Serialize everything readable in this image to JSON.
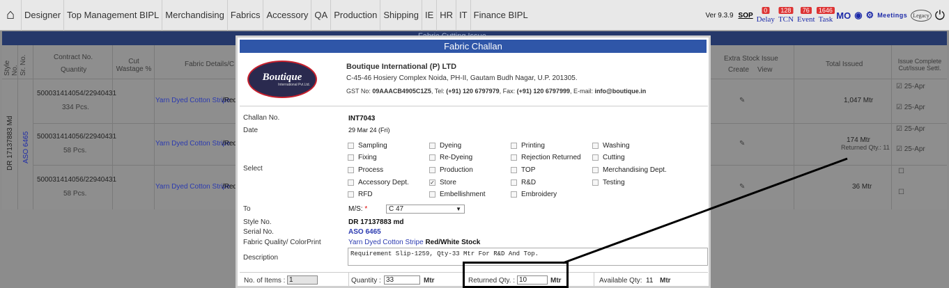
{
  "topbar": {
    "menu": [
      "Designer",
      "Top Management BIPL",
      "Merchandising",
      "Fabrics",
      "Accessory",
      "QA",
      "Production",
      "Shipping",
      "IE",
      "HR",
      "IT",
      "Finance BIPL"
    ],
    "version": "Ver 9.3.9",
    "sop": "SOP",
    "delay_label": "Delay",
    "delay_count": "0",
    "tcn_label": "TCN",
    "tcn_count": "128",
    "event_label": "Event",
    "event_count": "76",
    "task_label": "Task",
    "task_count": "1646",
    "mo_label": "MO",
    "meetings": "Meetings",
    "legacy": "Legacy"
  },
  "background": {
    "title": "Fabric Cutting Issue",
    "headers": {
      "style_no": "Style No.",
      "sr_no": "Sr. No.",
      "contract": "Contract No.",
      "quantity": "Quantity",
      "cut_wastage": "Cut Wastage %",
      "fabric_details": "Fabric Details/C",
      "extra_stock": "Extra Stock Issue",
      "create": "Create",
      "view": "View",
      "total_issued": "Total Issued",
      "issue_complete": "Issue Complete Cut/Issue Settl."
    },
    "style": "DR 17137883 Md",
    "serial": "ASO 6465",
    "rows": [
      {
        "contract": "500031414054/22940431",
        "qty": "334 Pcs.",
        "fabric": "Yarn Dyed Cotton Stripe",
        "fabric_b": "/Red",
        "issued": "1,047 Mtr",
        "returned": "",
        "d1": "25-Apr",
        "d2": "25-Apr"
      },
      {
        "contract": "500031414056/22940431",
        "qty": "58 Pcs.",
        "fabric": "Yarn Dyed Cotton Stripe",
        "fabric_b": "/Red",
        "issued": "174 Mtr",
        "returned": "Returned Qty.: 11",
        "d1": "25-Apr",
        "d2": "25-Apr"
      },
      {
        "contract": "500031414056/22940431",
        "qty": "58 Pcs.",
        "fabric": "Yarn Dyed Cotton Stripe",
        "fabric_b": "/Red",
        "issued": "36 Mtr",
        "returned": "",
        "d1": "",
        "d2": ""
      }
    ]
  },
  "modal": {
    "title": "Fabric Challan",
    "logo_text": "Boutique",
    "logo_sub": "International Pvt.Ltd.",
    "company": "Boutique International (P) LTD",
    "address": "C-45-46 Hosiery Complex Noida, PH-II, Gautam Budh Nagar, U.P. 201305.",
    "gst_label": "GST No:",
    "gst": "09AAACB4905C1Z5",
    "tel_label": ", Tel:",
    "tel": "(+91) 120 6797979",
    "fax_label": ", Fax:",
    "fax": "(+91) 120 6797999",
    "email_label": ", E-mail:",
    "email": "info@boutique.in",
    "challan_label": "Challan No.",
    "challan": "INT7043",
    "date_label": "Date",
    "date": "29 Mar 24 (Fri)",
    "select_label": "Select",
    "options": [
      {
        "label": "Sampling",
        "checked": false
      },
      {
        "label": "Dyeing",
        "checked": false
      },
      {
        "label": "Printing",
        "checked": false
      },
      {
        "label": "Washing",
        "checked": false
      },
      {
        "label": "Fixing",
        "checked": false
      },
      {
        "label": "Re-Dyeing",
        "checked": false
      },
      {
        "label": "Rejection Returned",
        "checked": false
      },
      {
        "label": "Cutting",
        "checked": false
      },
      {
        "label": "Process",
        "checked": false
      },
      {
        "label": "Production",
        "checked": false
      },
      {
        "label": "TOP",
        "checked": false
      },
      {
        "label": "Merchandising Dept.",
        "checked": false
      },
      {
        "label": "Accessory Dept.",
        "checked": false
      },
      {
        "label": "Store",
        "checked": true
      },
      {
        "label": "R&D",
        "checked": false
      },
      {
        "label": "Testing",
        "checked": false
      },
      {
        "label": "RFD",
        "checked": false
      },
      {
        "label": "Embellishment",
        "checked": false
      },
      {
        "label": "Embroidery",
        "checked": false
      }
    ],
    "to_label": "To",
    "ms_label": "M/S:",
    "required": "*",
    "ms_value": "C 47",
    "style_label": "Style No.",
    "style": "DR 17137883 md",
    "serial_label": "Serial No.",
    "serial": "ASO 6465",
    "quality_label": "Fabric Quality/ ColorPrint",
    "quality": "Yarn Dyed Cotton Stripe",
    "color": "Red/White Stock",
    "desc_label": "Description",
    "description": "Requirement Slip-1259, Qty-33 Mtr For R&D And Top.",
    "items_label": "No. of Items :",
    "items": "1",
    "qty_label": "Quantity :",
    "qty": "33",
    "mtr": "Mtr",
    "ret_label": "Returned Qty. :",
    "ret": "10",
    "avail_label": "Available Qty:",
    "avail": "11"
  }
}
